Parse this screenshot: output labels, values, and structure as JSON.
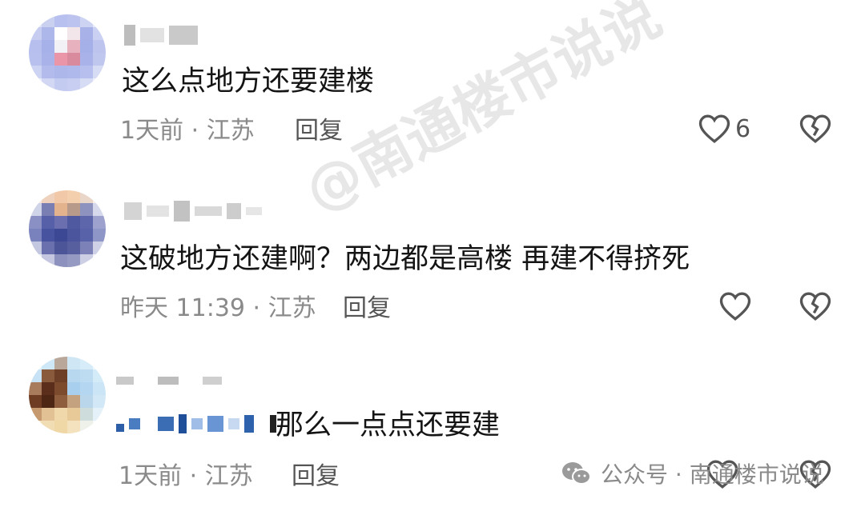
{
  "comments": [
    {
      "text": "这么点地方还要建楼",
      "meta": "1天前 · 江苏",
      "reply_label": "回复",
      "like_count": "6"
    },
    {
      "text": "这破地方还建啊？两边都是高楼  再建不得挤死",
      "meta": "昨天 11:39 · 江苏",
      "reply_label": "回复",
      "like_count": ""
    },
    {
      "text": "那么一点点还要建",
      "meta": "1天前 · 江苏",
      "reply_label": "回复",
      "like_count": ""
    }
  ],
  "watermark": {
    "center_text": "@南通楼市说说",
    "footer_text": "公众号 · 南通楼市说说"
  },
  "icons": {
    "like": "heart-outline-icon",
    "dislike": "broken-heart-icon",
    "wechat": "wechat-icon"
  },
  "colors": {
    "meta": "#8a8a8a",
    "text": "#141414",
    "icon": "#555555"
  }
}
